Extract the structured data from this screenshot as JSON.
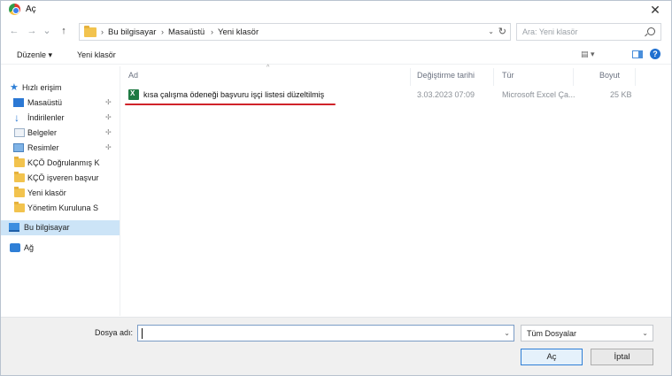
{
  "window": {
    "title": "Aç",
    "close_symbol": "✕"
  },
  "nav": {
    "back": "←",
    "forward": "→",
    "recent": "⌄",
    "up": "↑"
  },
  "address": {
    "separator": "›",
    "crumbs": [
      "Bu bilgisayar",
      "Masaüstü",
      "Yeni klasör"
    ],
    "dropdown": "⌄",
    "refresh": "↻"
  },
  "search": {
    "placeholder": "Ara: Yeni klasör"
  },
  "toolbar": {
    "organize": "Düzenle ▾",
    "new_folder": "Yeni klasör",
    "view": "▤ ▾",
    "help": "?"
  },
  "sidebar": {
    "items": [
      {
        "label": "Hızlı erişim",
        "icon": "star-icon",
        "pinned": false
      },
      {
        "label": "Masaüstü",
        "icon": "desktop-icon",
        "pinned": true
      },
      {
        "label": "İndirilenler",
        "icon": "download-icon",
        "pinned": true
      },
      {
        "label": "Belgeler",
        "icon": "documents-icon",
        "pinned": true
      },
      {
        "label": "Resimler",
        "icon": "pictures-icon",
        "pinned": true
      },
      {
        "label": "KÇÖ Doğrulanmış K",
        "icon": "folder-icon",
        "pinned": false
      },
      {
        "label": "KÇÖ işveren başvur",
        "icon": "folder-icon",
        "pinned": false
      },
      {
        "label": "Yeni klasör",
        "icon": "folder-icon",
        "pinned": false
      },
      {
        "label": "Yönetim Kuruluna S",
        "icon": "folder-icon",
        "pinned": false
      },
      {
        "label": "Bu bilgisayar",
        "icon": "computer-icon",
        "pinned": false
      },
      {
        "label": "Ağ",
        "icon": "network-icon",
        "pinned": false
      }
    ],
    "pin_symbol": "✢"
  },
  "columns": {
    "name": "Ad",
    "modified": "Değiştirme tarihi",
    "type": "Tür",
    "size": "Boyut",
    "sort_indicator": "^"
  },
  "files": [
    {
      "name": "kısa çalışma ödeneği başvuru işçi listesi düzeltilmiş",
      "modified": "3.03.2023 07:09",
      "type": "Microsoft Excel Ça...",
      "size": "25 KB"
    }
  ],
  "bottom": {
    "filename_label": "Dosya adı:",
    "filename_value": "",
    "filetype": "Tüm Dosyalar",
    "dropdown": "⌄",
    "open_label": "Aç",
    "cancel_label": "İptal"
  },
  "colors": {
    "accent": "#2f7fd6",
    "selection": "#cce4f7",
    "highlight_underline": "#d0232a"
  }
}
